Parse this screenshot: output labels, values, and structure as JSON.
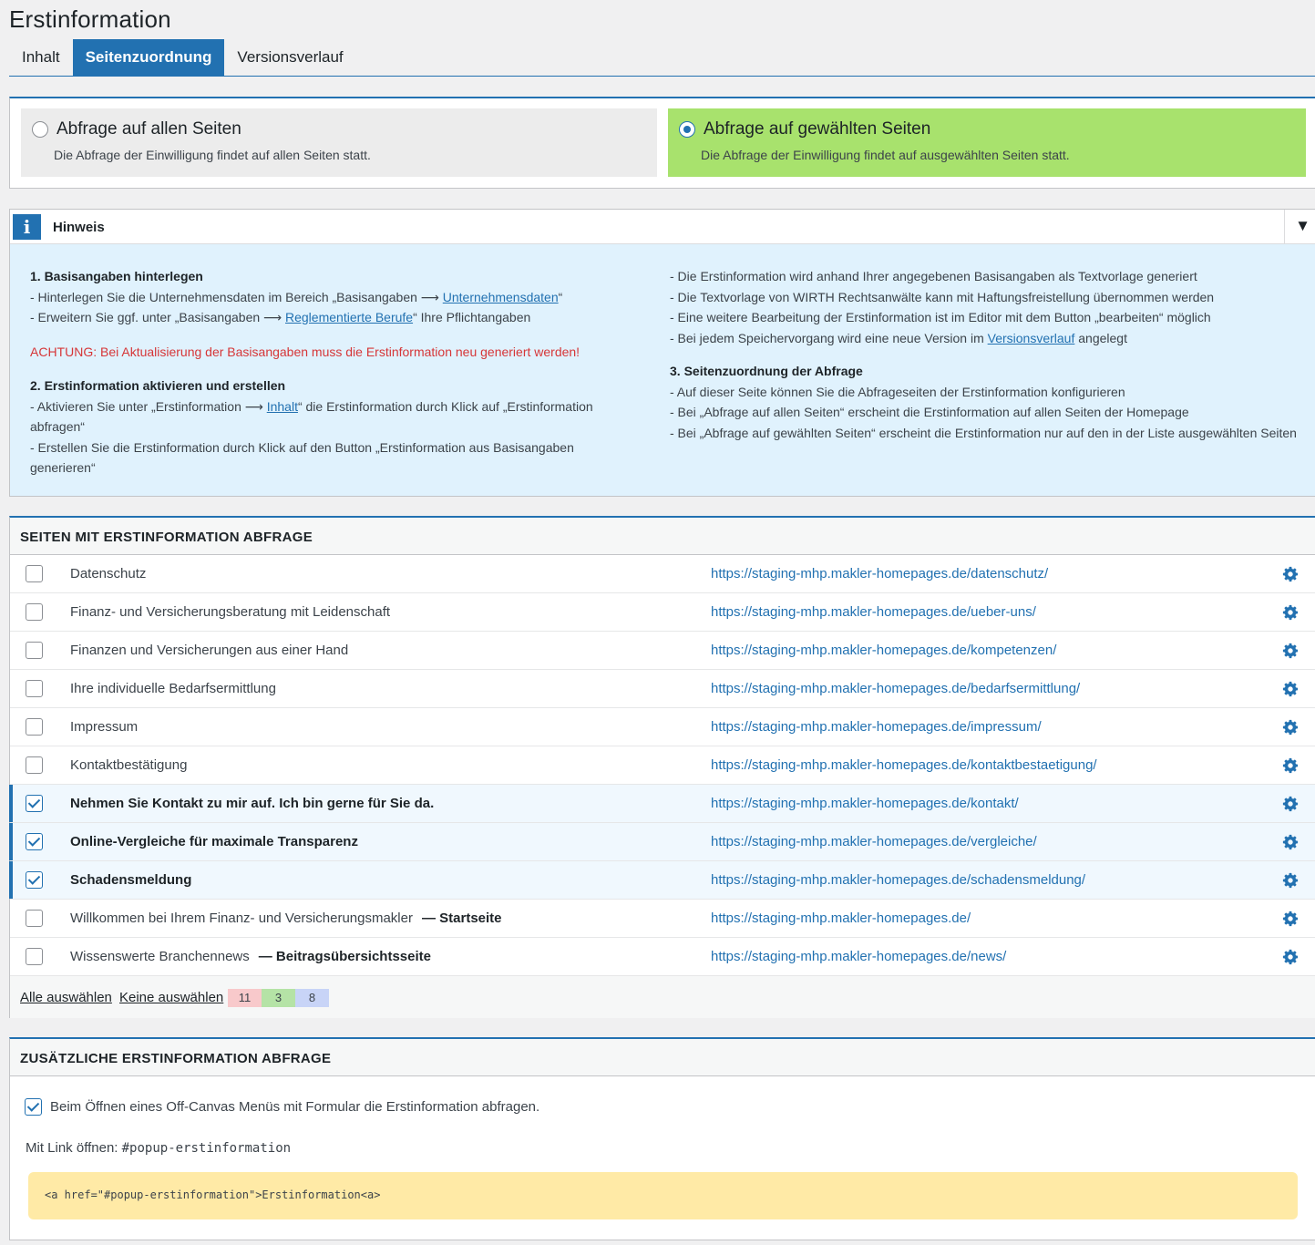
{
  "page": {
    "title": "Erstinformation"
  },
  "tabs": [
    {
      "label": "Inhalt",
      "active": false
    },
    {
      "label": "Seitenzuordnung",
      "active": true
    },
    {
      "label": "Versionsverlauf",
      "active": false
    }
  ],
  "scope": {
    "all": {
      "label": "Abfrage auf allen Seiten",
      "desc": "Die Abfrage der Einwilligung findet auf allen Seiten statt.",
      "selected": false
    },
    "selected": {
      "label": "Abfrage auf gewählten Seiten",
      "desc": "Die Abfrage der Einwilligung findet auf ausgewählten Seiten statt.",
      "selected": true
    },
    "highlight_color": "#a8e26d"
  },
  "hint": {
    "icon": "i",
    "title": "Hinweis",
    "toggle": "▼",
    "s1_title": "1. Basisangaben hinterlegen",
    "s1_l1_pre": "- Hinterlegen Sie die Unternehmensdaten im Bereich „Basisangaben ⟶ ",
    "s1_l1_link": "Unternehmensdaten",
    "s1_l1_post": "“",
    "s1_l2_pre": "- Erweitern Sie ggf. unter „Basisangaben ⟶ ",
    "s1_l2_link": "Reglementierte Berufe",
    "s1_l2_post": "“ Ihre Pflichtangaben",
    "warning": "ACHTUNG: Bei Aktualisierung der Basisangaben muss die Erstinformation neu generiert werden!",
    "s2_title": "2. Erstinformation aktivieren und erstellen",
    "s2_l1_pre": "- Aktivieren Sie unter „Erstinformation ⟶ ",
    "s2_l1_link": "Inhalt",
    "s2_l1_post": "“ die Erstinformation durch Klick auf „Erstinformation abfragen“",
    "s2_l2": "- Erstellen Sie die Erstinformation durch Klick auf den Button „Erstinformation aus Basisangaben generieren“",
    "r_l1": "- Die Erstinformation wird anhand Ihrer angegebenen Basisangaben als Textvorlage generiert",
    "r_l2": "- Die Textvorlage von WIRTH Rechtsanwälte kann mit Haftungsfreistellung übernommen werden",
    "r_l3": "- Eine weitere Bearbeitung der Erstinformation ist im Editor mit dem Button „bearbeiten“ möglich",
    "r_l4_pre": "- Bei jedem Speichervorgang wird eine neue Version im ",
    "r_l4_link": "Versionsverlauf",
    "r_l4_post": " angelegt",
    "s3_title": "3. Seitenzuordnung der Abfrage",
    "s3_l1": "- Auf dieser Seite können Sie die Abfrageseiten der Erstinformation konfigurieren",
    "s3_l2": "- Bei „Abfrage auf allen Seiten“ erscheint die Erstinformation auf allen Seiten der Homepage",
    "s3_l3": "- Bei „Abfrage auf gewählten Seiten“ erscheint die Erstinformation nur auf den in der Liste ausgewählten Seiten"
  },
  "pages_section": {
    "title": "SEITEN MIT ERSTINFORMATION ABFRAGE",
    "rows": [
      {
        "title": "Datenschutz",
        "suffix": "",
        "url": "https://staging-mhp.makler-homepages.de/datenschutz/",
        "checked": false
      },
      {
        "title": "Finanz- und Versicherungsberatung mit Leidenschaft",
        "suffix": "",
        "url": "https://staging-mhp.makler-homepages.de/ueber-uns/",
        "checked": false
      },
      {
        "title": "Finanzen und Versicherungen aus einer Hand",
        "suffix": "",
        "url": "https://staging-mhp.makler-homepages.de/kompetenzen/",
        "checked": false
      },
      {
        "title": "Ihre individuelle Bedarfsermittlung",
        "suffix": "",
        "url": "https://staging-mhp.makler-homepages.de/bedarfsermittlung/",
        "checked": false
      },
      {
        "title": "Impressum",
        "suffix": "",
        "url": "https://staging-mhp.makler-homepages.de/impressum/",
        "checked": false
      },
      {
        "title": "Kontaktbestätigung",
        "suffix": "",
        "url": "https://staging-mhp.makler-homepages.de/kontaktbestaetigung/",
        "checked": false
      },
      {
        "title": "Nehmen Sie Kontakt zu mir auf. Ich bin gerne für Sie da.",
        "suffix": "",
        "url": "https://staging-mhp.makler-homepages.de/kontakt/",
        "checked": true
      },
      {
        "title": "Online-Vergleiche für maximale Transparenz",
        "suffix": "",
        "url": "https://staging-mhp.makler-homepages.de/vergleiche/",
        "checked": true
      },
      {
        "title": "Schadensmeldung",
        "suffix": "",
        "url": "https://staging-mhp.makler-homepages.de/schadensmeldung/",
        "checked": true
      },
      {
        "title": "Willkommen bei Ihrem Finanz- und Versicherungsmakler",
        "suffix": "— Startseite",
        "url": "https://staging-mhp.makler-homepages.de/",
        "checked": false
      },
      {
        "title": "Wissenswerte Branchennews",
        "suffix": "— Beitragsübersichtsseite",
        "url": "https://staging-mhp.makler-homepages.de/news/",
        "checked": false
      }
    ],
    "select_all": "Alle auswählen",
    "select_none": "Keine auswählen",
    "counts": [
      {
        "value": "11",
        "color": "#f8c9cb"
      },
      {
        "value": "3",
        "color": "#b5e3a6"
      },
      {
        "value": "8",
        "color": "#c8d4f7"
      }
    ],
    "row_icon": "gear-icon"
  },
  "extra_section": {
    "title": "ZUSÄTZLICHE ERSTINFORMATION ABFRAGE",
    "offcanvas_label": "Beim Öffnen eines Off-Canvas Menüs mit Formular die Erstinformation abfragen.",
    "offcanvas_checked": true,
    "link_label": "Mit Link öffnen: ",
    "link_anchor": "#popup-erstinformation",
    "code": "<a href=\"#popup-erstinformation\">Erstinformation<a>"
  }
}
